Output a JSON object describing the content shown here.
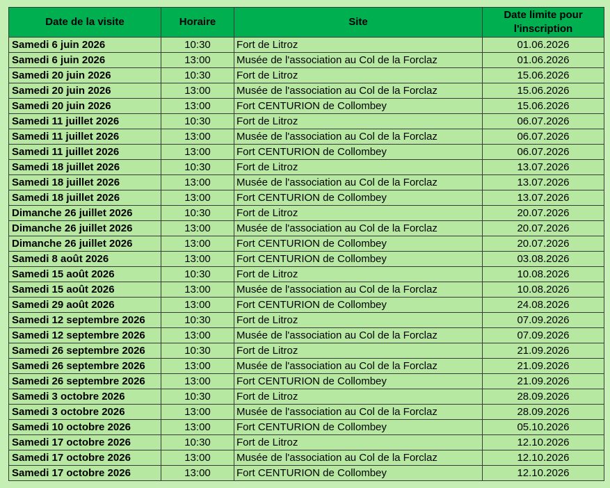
{
  "table": {
    "headers": {
      "date": "Date de la visite",
      "time": "Horaire",
      "site": "Site",
      "deadline_line1": "Date limite pour",
      "deadline_line2": "l'inscription"
    },
    "rows": [
      {
        "date": "Samedi 6 juin 2026",
        "time": "10:30",
        "site": "Fort de Litroz",
        "deadline": "01.06.2026"
      },
      {
        "date": "Samedi 6 juin 2026",
        "time": "13:00",
        "site": "Musée de l'association au Col de la Forclaz",
        "deadline": "01.06.2026"
      },
      {
        "date": "Samedi 20 juin 2026",
        "time": "10:30",
        "site": "Fort de Litroz",
        "deadline": "15.06.2026"
      },
      {
        "date": "Samedi 20 juin 2026",
        "time": "13:00",
        "site": "Musée de l'association au Col de la Forclaz",
        "deadline": "15.06.2026"
      },
      {
        "date": "Samedi 20 juin 2026",
        "time": "13:00",
        "site": "Fort CENTURION de Collombey",
        "deadline": "15.06.2026"
      },
      {
        "date": "Samedi 11 juillet 2026",
        "time": "10:30",
        "site": "Fort de Litroz",
        "deadline": "06.07.2026"
      },
      {
        "date": "Samedi 11 juillet 2026",
        "time": "13:00",
        "site": "Musée de l'association au Col de la Forclaz",
        "deadline": "06.07.2026"
      },
      {
        "date": "Samedi 11 juillet 2026",
        "time": "13:00",
        "site": "Fort CENTURION de Collombey",
        "deadline": "06.07.2026"
      },
      {
        "date": "Samedi 18 juillet 2026",
        "time": "10:30",
        "site": "Fort de Litroz",
        "deadline": "13.07.2026"
      },
      {
        "date": "Samedi 18 juillet 2026",
        "time": "13:00",
        "site": "Musée de l'association au Col de la Forclaz",
        "deadline": "13.07.2026"
      },
      {
        "date": "Samedi 18 juillet 2026",
        "time": "13:00",
        "site": "Fort CENTURION de Collombey",
        "deadline": "13.07.2026"
      },
      {
        "date": "Dimanche 26 juillet 2026",
        "time": "10:30",
        "site": "Fort de Litroz",
        "deadline": "20.07.2026"
      },
      {
        "date": "Dimanche 26 juillet 2026",
        "time": "13:00",
        "site": "Musée de l'association au Col de la Forclaz",
        "deadline": "20.07.2026"
      },
      {
        "date": "Dimanche 26 juillet 2026",
        "time": "13:00",
        "site": "Fort CENTURION de Collombey",
        "deadline": "20.07.2026"
      },
      {
        "date": "Samedi 8 août 2026",
        "time": "13:00",
        "site": "Fort CENTURION de Collombey",
        "deadline": "03.08.2026"
      },
      {
        "date": "Samedi 15 août 2026",
        "time": "10:30",
        "site": "Fort de Litroz",
        "deadline": "10.08.2026"
      },
      {
        "date": "Samedi 15 août 2026",
        "time": "13:00",
        "site": "Musée de l'association au Col de la Forclaz",
        "deadline": "10.08.2026"
      },
      {
        "date": "Samedi 29 août 2026",
        "time": "13:00",
        "site": "Fort CENTURION de Collombey",
        "deadline": "24.08.2026"
      },
      {
        "date": "Samedi 12 septembre 2026",
        "time": "10:30",
        "site": "Fort de Litroz",
        "deadline": "07.09.2026"
      },
      {
        "date": "Samedi 12 septembre 2026",
        "time": "13:00",
        "site": "Musée de l'association au Col de la Forclaz",
        "deadline": "07.09.2026"
      },
      {
        "date": "Samedi 26 septembre 2026",
        "time": "10:30",
        "site": "Fort de Litroz",
        "deadline": "21.09.2026"
      },
      {
        "date": "Samedi 26 septembre 2026",
        "time": "13:00",
        "site": "Musée de l'association au Col de la Forclaz",
        "deadline": "21.09.2026"
      },
      {
        "date": "Samedi 26 septembre 2026",
        "time": "13:00",
        "site": "Fort CENTURION de Collombey",
        "deadline": "21.09.2026"
      },
      {
        "date": "Samedi 3 octobre 2026",
        "time": "10:30",
        "site": "Fort de Litroz",
        "deadline": "28.09.2026"
      },
      {
        "date": "Samedi 3 octobre 2026",
        "time": "13:00",
        "site": "Musée de l'association au Col de la Forclaz",
        "deadline": "28.09.2026"
      },
      {
        "date": "Samedi 10 octobre 2026",
        "time": "13:00",
        "site": "Fort CENTURION de Collombey",
        "deadline": "05.10.2026"
      },
      {
        "date": "Samedi 17 octobre 2026",
        "time": "10:30",
        "site": "Fort de Litroz",
        "deadline": "12.10.2026"
      },
      {
        "date": "Samedi 17 octobre 2026",
        "time": "13:00",
        "site": "Musée de l'association au Col de la Forclaz",
        "deadline": "12.10.2026"
      },
      {
        "date": "Samedi 17 octobre 2026",
        "time": "13:00",
        "site": "Fort CENTURION de Collombey",
        "deadline": "12.10.2026"
      }
    ]
  },
  "colors": {
    "page_background": "#c6efb6",
    "header_background": "#00b050",
    "row_background": "#b6e8a2",
    "border": "#3a3a3a"
  }
}
